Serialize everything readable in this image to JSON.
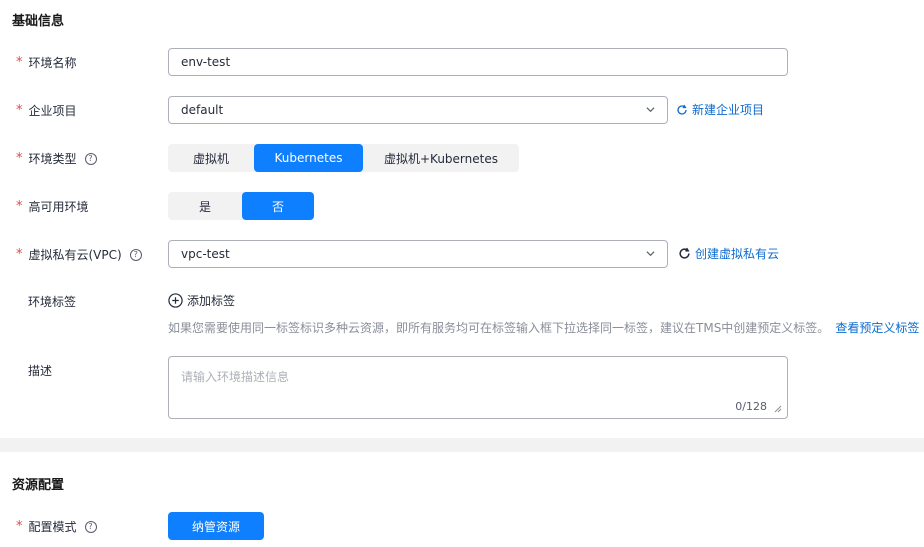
{
  "basic": {
    "title": "基础信息",
    "env_name": {
      "label": "环境名称",
      "value": "env-test"
    },
    "enterprise_project": {
      "label": "企业项目",
      "value": "default",
      "link": "新建企业项目"
    },
    "env_type": {
      "label": "环境类型",
      "options": [
        "虚拟机",
        "Kubernetes",
        "虚拟机+Kubernetes"
      ],
      "selected": "Kubernetes"
    },
    "ha": {
      "label": "高可用环境",
      "options": [
        "是",
        "否"
      ],
      "selected": "否"
    },
    "vpc": {
      "label": "虚拟私有云(VPC)",
      "value": "vpc-test",
      "link": "创建虚拟私有云"
    },
    "tags": {
      "label": "环境标签",
      "add": "添加标签",
      "hint": "如果您需要使用同一标签标识多种云资源，即所有服务均可在标签输入框下拉选择同一标签，建议在TMS中创建预定义标签。",
      "hint_link": "查看预定义标签"
    },
    "desc": {
      "label": "描述",
      "placeholder": "请输入环境描述信息",
      "count": "0/128"
    }
  },
  "resource": {
    "title": "资源配置",
    "mode": {
      "label": "配置模式",
      "button": "纳管资源"
    }
  },
  "colors": {
    "primary": "#0d7fff",
    "link": "#0d6bce",
    "required": "#e54545"
  }
}
